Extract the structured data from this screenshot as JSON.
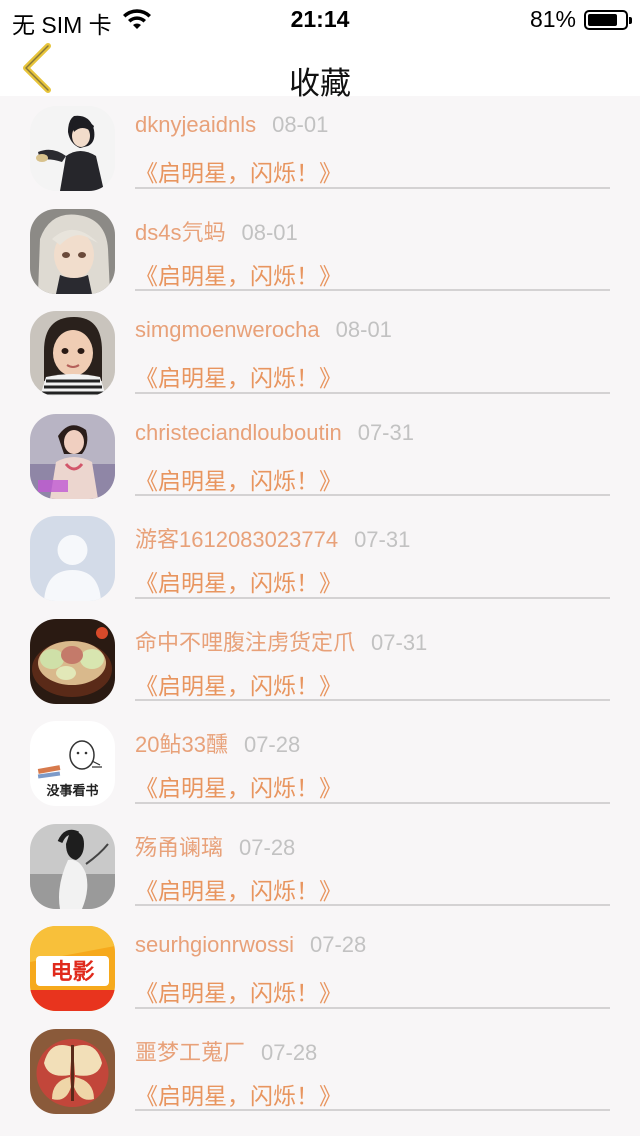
{
  "status_bar": {
    "carrier": "无 SIM 卡",
    "time": "21:14",
    "battery_percent": "81%",
    "battery_level": 0.81
  },
  "nav": {
    "title": "收藏",
    "back_icon": "chevron-left-icon",
    "accent_color": "#e7c43a"
  },
  "favorites": [
    {
      "username": "dknyjeaidnls",
      "date": "08-01",
      "title": "《启明星，闪烁！》",
      "avatar": "anime-boy-avatar"
    },
    {
      "username": "ds4s氕蚂",
      "date": "08-01",
      "title": "《启明星，闪烁！》",
      "avatar": "anime-white-hair-avatar"
    },
    {
      "username": "simgmoenwerocha",
      "date": "08-01",
      "title": "《启明星，闪烁！》",
      "avatar": "child-photo-avatar"
    },
    {
      "username": "christeciandlouboutin",
      "date": "07-31",
      "title": "《启明星，闪烁！》",
      "avatar": "woman-photo-avatar"
    },
    {
      "username": "游客1612083023774",
      "date": "07-31",
      "title": "《启明星，闪烁！》",
      "avatar": "default-user-avatar"
    },
    {
      "username": "命中不哩腹注虏货定爪",
      "date": "07-31",
      "title": "《启明星，闪烁！》",
      "avatar": "food-bowl-avatar"
    },
    {
      "username": "20鲇33醺",
      "date": "07-28",
      "title": "《启明星，闪烁！》",
      "avatar": "reading-doodle-avatar",
      "avatar_text": "没事看书"
    },
    {
      "username": "殇甬谰璃",
      "date": "07-28",
      "title": "《启明星，闪烁！》",
      "avatar": "bw-portrait-avatar"
    },
    {
      "username": "seurhgionrwossi",
      "date": "07-28",
      "title": "《启明星，闪烁！》",
      "avatar": "movie-logo-avatar",
      "avatar_text": "电影"
    },
    {
      "username": "噩梦工蒐厂",
      "date": "07-28",
      "title": "《启明星，闪烁！》",
      "avatar": "apple-butterfly-avatar"
    }
  ],
  "colors": {
    "username": "#e8a179",
    "date": "#c2c2c2",
    "title": "#e8955f",
    "background": "#f8f6f7"
  }
}
